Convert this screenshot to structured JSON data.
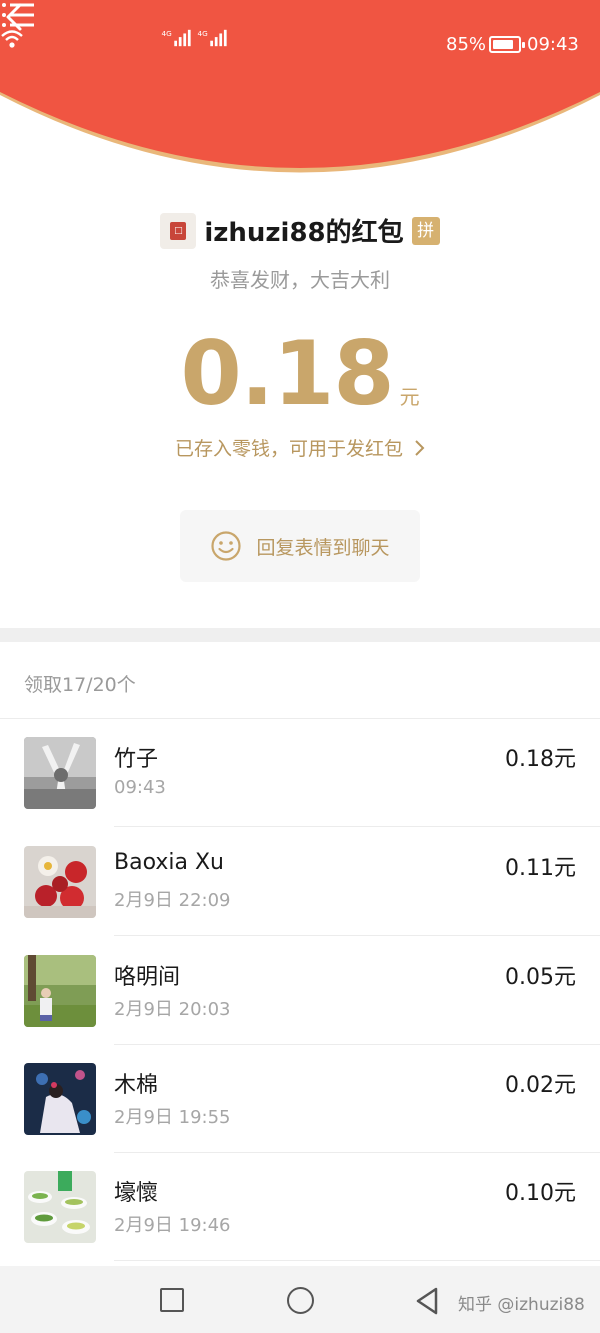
{
  "status_bar": {
    "signal1": "4G",
    "signal2": "4G",
    "battery_pct": "85%",
    "battery_level": 0.85,
    "time": "09:43"
  },
  "colors": {
    "header_red": "#f05542",
    "gold": "#c9a66b",
    "gold_text": "#b8975f"
  },
  "header": {
    "back_icon": "chevron-left-icon",
    "menu_icon": "list-menu-icon"
  },
  "sender": {
    "name": "izhuzi88的红包",
    "badge": "拼",
    "wish": "恭喜发财，大吉大利"
  },
  "amount": {
    "value": "0.18",
    "unit": "元"
  },
  "saved_link": "已存入零钱，可用于发红包",
  "reply_button": "回复表情到聊天",
  "received_summary": "领取17/20个",
  "records": [
    {
      "name": "竹子",
      "time": "09:43",
      "amount": "0.18元"
    },
    {
      "name": "Baoxia Xu",
      "time": "2月9日  22:09",
      "amount": "0.11元"
    },
    {
      "name": "咯明间",
      "time": "2月9日  20:03",
      "amount": "0.05元"
    },
    {
      "name": "木棉",
      "time": "2月9日  19:55",
      "amount": "0.02元"
    },
    {
      "name": "壕懷",
      "time": "2月9日  19:46",
      "amount": "0.10元"
    }
  ],
  "navbar": {
    "watermark": "知乎 @izhuzi88"
  }
}
